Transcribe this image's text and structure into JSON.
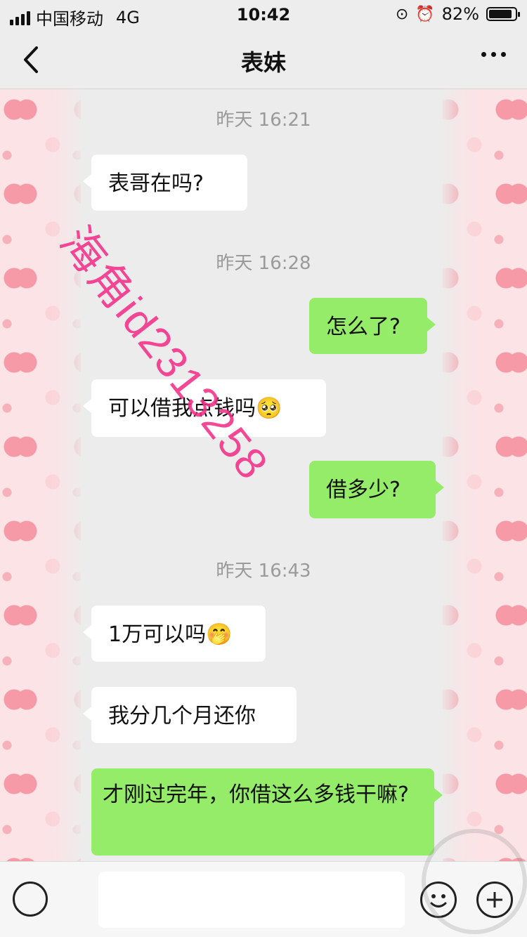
{
  "status_bar": {
    "carrier": "中国移动",
    "network": "4G",
    "time": "10:42",
    "battery": "82%"
  },
  "nav": {
    "title": "表妹"
  },
  "chat": {
    "timestamps": [
      "昨天 16:21",
      "昨天 16:28",
      "昨天 16:43"
    ],
    "messages": [
      {
        "side": "in",
        "text": "表哥在吗?"
      },
      {
        "side": "out",
        "text": "怎么了?"
      },
      {
        "side": "in",
        "text": "可以借我点钱吗",
        "emoji": "🥺"
      },
      {
        "side": "out",
        "text": "借多少?"
      },
      {
        "side": "in",
        "text": "1万可以吗",
        "emoji": "🤭"
      },
      {
        "side": "in",
        "text": "我分几个月还你"
      },
      {
        "side": "out",
        "text": "才刚过完年，你借这么多钱干嘛?"
      }
    ]
  },
  "watermark": "海角id2313258"
}
